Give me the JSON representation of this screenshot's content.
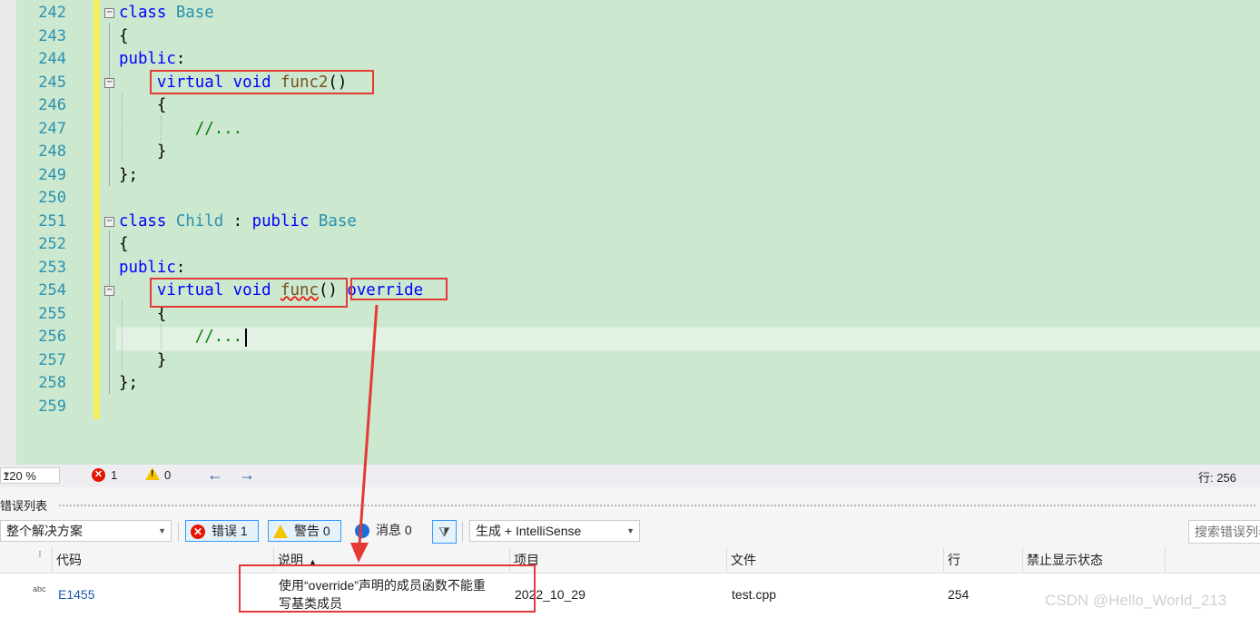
{
  "editor": {
    "lines": [
      {
        "num": "242",
        "code": [
          {
            "t": "class ",
            "c": "kw"
          },
          {
            "t": "Base",
            "c": "ty"
          }
        ]
      },
      {
        "num": "243",
        "code": [
          {
            "t": "{",
            "c": ""
          }
        ]
      },
      {
        "num": "244",
        "code": [
          {
            "t": "public",
            "c": "kw"
          },
          {
            "t": ":",
            "c": ""
          }
        ]
      },
      {
        "num": "245",
        "code": [
          {
            "t": "    ",
            "c": ""
          },
          {
            "t": "virtual",
            "c": "kw"
          },
          {
            "t": " ",
            "c": ""
          },
          {
            "t": "void",
            "c": "kw"
          },
          {
            "t": " ",
            "c": ""
          },
          {
            "t": "func2",
            "c": "fn"
          },
          {
            "t": "()",
            "c": ""
          }
        ]
      },
      {
        "num": "246",
        "code": [
          {
            "t": "    {",
            "c": ""
          }
        ]
      },
      {
        "num": "247",
        "code": [
          {
            "t": "        ",
            "c": ""
          },
          {
            "t": "//...",
            "c": "cm"
          }
        ]
      },
      {
        "num": "248",
        "code": [
          {
            "t": "    }",
            "c": ""
          }
        ]
      },
      {
        "num": "249",
        "code": [
          {
            "t": "};",
            "c": ""
          }
        ]
      },
      {
        "num": "250",
        "code": []
      },
      {
        "num": "251",
        "code": [
          {
            "t": "class ",
            "c": "kw"
          },
          {
            "t": "Child",
            "c": "ty"
          },
          {
            "t": " : ",
            "c": ""
          },
          {
            "t": "public",
            "c": "kw"
          },
          {
            "t": " ",
            "c": ""
          },
          {
            "t": "Base",
            "c": "ty"
          }
        ]
      },
      {
        "num": "252",
        "code": [
          {
            "t": "{",
            "c": ""
          }
        ]
      },
      {
        "num": "253",
        "code": [
          {
            "t": "public",
            "c": "kw"
          },
          {
            "t": ":",
            "c": ""
          }
        ]
      },
      {
        "num": "254",
        "code": [
          {
            "t": "    ",
            "c": ""
          },
          {
            "t": "virtual",
            "c": "kw"
          },
          {
            "t": " ",
            "c": ""
          },
          {
            "t": "void",
            "c": "kw"
          },
          {
            "t": " ",
            "c": ""
          },
          {
            "t": "func",
            "c": "fn squig"
          },
          {
            "t": "() ",
            "c": ""
          },
          {
            "t": "override",
            "c": "kw"
          }
        ]
      },
      {
        "num": "255",
        "code": [
          {
            "t": "    {",
            "c": ""
          }
        ]
      },
      {
        "num": "256",
        "code": [
          {
            "t": "        ",
            "c": ""
          },
          {
            "t": "//...",
            "c": "cm"
          }
        ]
      },
      {
        "num": "257",
        "code": [
          {
            "t": "    }",
            "c": ""
          }
        ]
      },
      {
        "num": "258",
        "code": [
          {
            "t": "};",
            "c": ""
          }
        ]
      },
      {
        "num": "259",
        "code": []
      }
    ],
    "fold_markers": [
      "242",
      "245",
      "251",
      "254"
    ]
  },
  "statusbar": {
    "zoom": "120 %",
    "errors": "1",
    "warnings": "0",
    "line_indicator": "行: 256"
  },
  "error_list": {
    "title": "错误列表",
    "scope": "整个解决方案",
    "errors_btn": "错误 1",
    "warnings_btn": "警告 0",
    "messages_btn": "消息 0",
    "build_source": "生成 + IntelliSense",
    "search_placeholder": "搜索错误列表",
    "columns": [
      "代码",
      "说明",
      "项目",
      "文件",
      "行",
      "禁止显示状态"
    ],
    "rows": [
      {
        "code": "E1455",
        "description_line1": "使用“override”声明的成员函数不能重",
        "description_line2": "写基类成员",
        "project": "2022_10_29",
        "file": "test.cpp",
        "line": "254",
        "suppression": ""
      }
    ]
  },
  "watermark": "CSDN @Hello_World_213",
  "colors": {
    "editor_bg": "#cce8cf",
    "keyword": "#0000ff",
    "type": "#2b91af",
    "function": "#74531f",
    "comment": "#008000",
    "annotation": "#e53935"
  }
}
